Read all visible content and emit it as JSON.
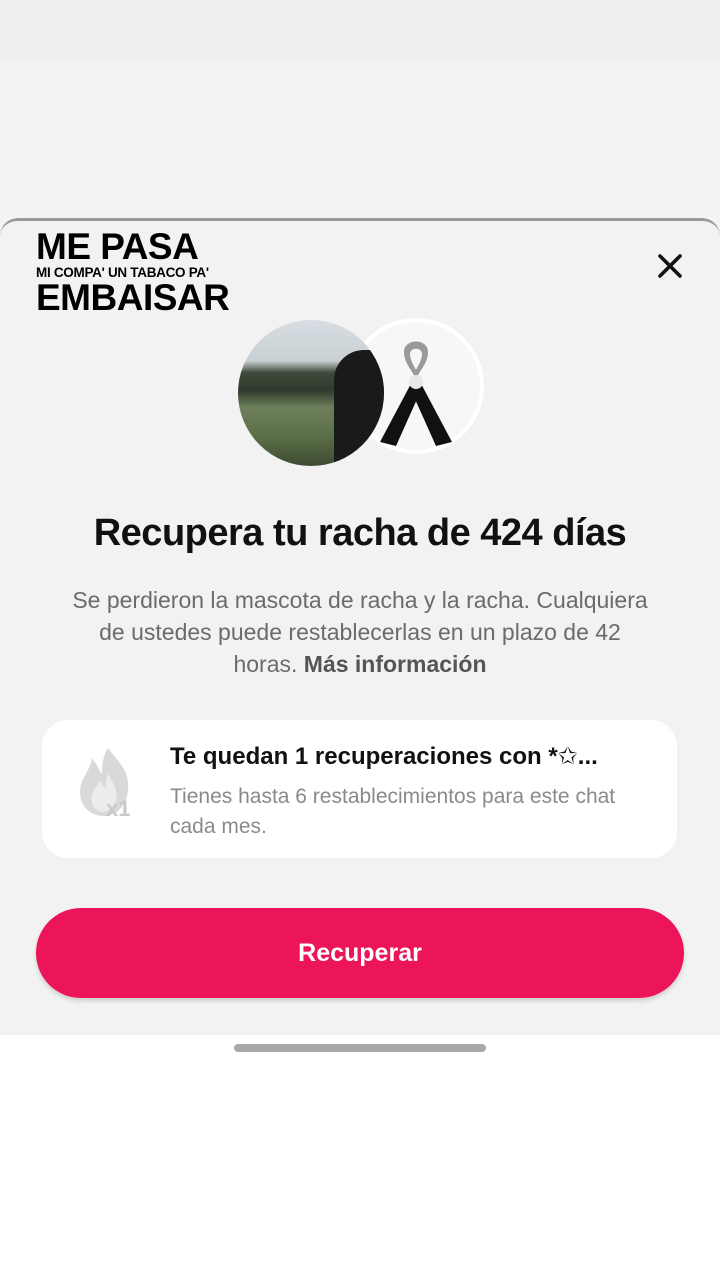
{
  "overlay_caption": {
    "line1": "ME PASA",
    "line2": "MI COMPA' UN TABACO PA'",
    "line3": "EMBAISAR"
  },
  "sheet": {
    "close_icon": "close-icon",
    "title": "Recupera tu racha de 424 días",
    "description": "Se perdieron la mascota de racha y la racha. Cualquiera de ustedes puede restablecerlas en un plazo de 42 horas.",
    "more_link": "Más información"
  },
  "recovery_card": {
    "icon": "flame-icon",
    "badge": "x1",
    "title": "Te quedan 1 recuperaciones con *✩...",
    "subtitle": "Tienes hasta 6 restablecimientos para este chat cada mes."
  },
  "primary_button": {
    "label": "Recuperar"
  },
  "colors": {
    "accent": "#ec1559",
    "sheet_background": "#f2f2f2",
    "card_background": "#ffffff"
  }
}
